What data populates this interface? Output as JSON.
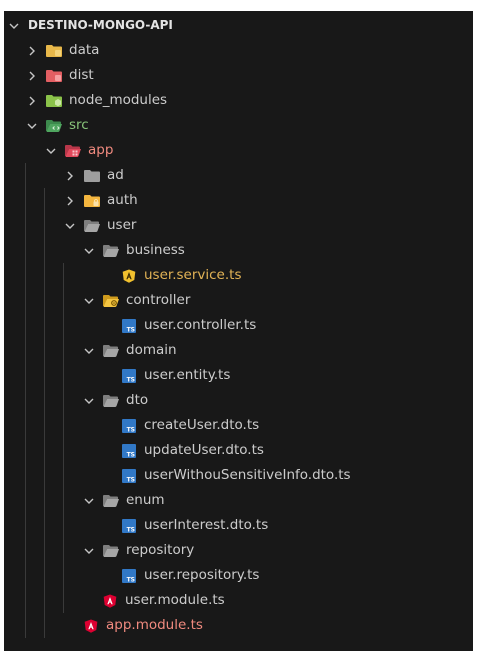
{
  "explorer": {
    "root": "DESTINO-MONGO-API",
    "items": [
      {
        "label": "data",
        "kind": "folder",
        "state": "collapsed",
        "color": "#e8b84a"
      },
      {
        "label": "dist",
        "kind": "folder",
        "state": "collapsed",
        "color": "#e35f63"
      },
      {
        "label": "node_modules",
        "kind": "folder",
        "state": "collapsed",
        "color": "#8bc34a"
      },
      {
        "label": "src",
        "kind": "folder",
        "state": "expanded",
        "color": "#4fa55f"
      },
      {
        "label": "app",
        "kind": "folder",
        "state": "expanded",
        "color": "#e0485b"
      },
      {
        "label": "ad",
        "kind": "folder",
        "state": "collapsed",
        "color": "#9e9e9e"
      },
      {
        "label": "auth",
        "kind": "folder",
        "state": "collapsed",
        "color": "#f4b63f"
      },
      {
        "label": "user",
        "kind": "folder",
        "state": "expanded",
        "color": "#9e9e9e"
      },
      {
        "label": "business",
        "kind": "folder",
        "state": "expanded",
        "color": "#9e9e9e"
      },
      {
        "label": "user.service.ts",
        "kind": "file",
        "icon": "angular-service-icon"
      },
      {
        "label": "controller",
        "kind": "folder",
        "state": "expanded",
        "color": "#f4c542"
      },
      {
        "label": "user.controller.ts",
        "kind": "file",
        "icon": "typescript-icon"
      },
      {
        "label": "domain",
        "kind": "folder",
        "state": "expanded",
        "color": "#9e9e9e"
      },
      {
        "label": "user.entity.ts",
        "kind": "file",
        "icon": "typescript-icon"
      },
      {
        "label": "dto",
        "kind": "folder",
        "state": "expanded",
        "color": "#9e9e9e"
      },
      {
        "label": "createUser.dto.ts",
        "kind": "file",
        "icon": "typescript-icon"
      },
      {
        "label": "updateUser.dto.ts",
        "kind": "file",
        "icon": "typescript-icon"
      },
      {
        "label": "userWithouSensitiveInfo.dto.ts",
        "kind": "file",
        "icon": "typescript-icon"
      },
      {
        "label": "enum",
        "kind": "folder",
        "state": "expanded",
        "color": "#9e9e9e"
      },
      {
        "label": "userInterest.dto.ts",
        "kind": "file",
        "icon": "typescript-icon"
      },
      {
        "label": "repository",
        "kind": "folder",
        "state": "expanded",
        "color": "#9e9e9e"
      },
      {
        "label": "user.repository.ts",
        "kind": "file",
        "icon": "typescript-icon"
      },
      {
        "label": "user.module.ts",
        "kind": "file",
        "icon": "angular-icon"
      },
      {
        "label": "app.module.ts",
        "kind": "file",
        "icon": "angular-icon"
      }
    ]
  },
  "colors": {
    "background": "#181818",
    "text": "#cccccc",
    "folder_label_src": "#88c47a",
    "folder_label_app": "#f08a7f",
    "file_label_modified": "#e2b356",
    "file_label_error": "#f08a7f",
    "typescript_icon": "#3178c6",
    "angular_icon": "#dd0031",
    "angular_service_icon": "#f2c12e"
  }
}
